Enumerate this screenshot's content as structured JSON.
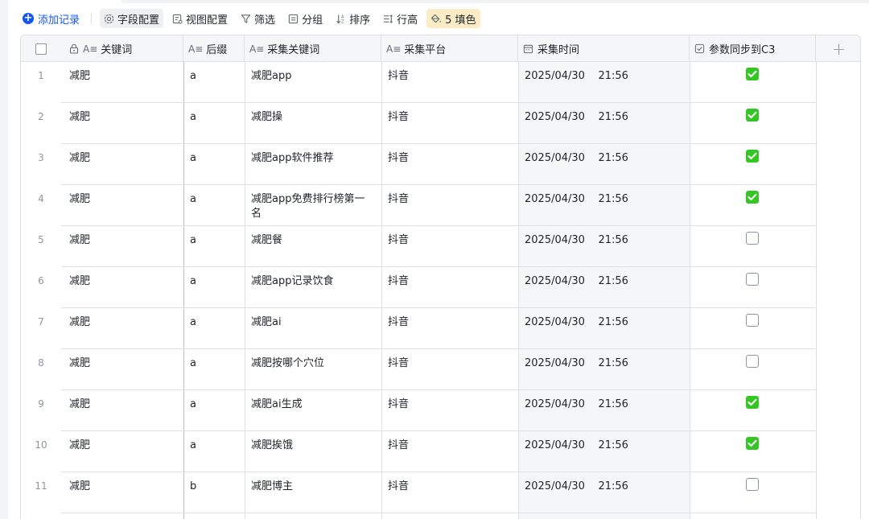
{
  "toolbar": {
    "add_label": "添加记录",
    "field_config": "字段配置",
    "view_config": "视图配置",
    "filter": "筛选",
    "group": "分组",
    "sort": "排序",
    "row_height": "行高",
    "fill": "5 填色"
  },
  "columns": {
    "keyword": "关键词",
    "suffix": "后缀",
    "collect_keyword": "采集关键词",
    "platform": "采集平台",
    "time": "采集时间",
    "sync": "参数同步到C3",
    "add": "+"
  },
  "rows": [
    {
      "idx": "1",
      "keyword": "减肥",
      "suffix": "a",
      "collect": "减肥app",
      "platform": "抖音",
      "time": "2025/04/30    21:56",
      "synced": true
    },
    {
      "idx": "2",
      "keyword": "减肥",
      "suffix": "a",
      "collect": "减肥操",
      "platform": "抖音",
      "time": "2025/04/30    21:56",
      "synced": true
    },
    {
      "idx": "3",
      "keyword": "减肥",
      "suffix": "a",
      "collect": "减肥app软件推荐",
      "platform": "抖音",
      "time": "2025/04/30    21:56",
      "synced": true
    },
    {
      "idx": "4",
      "keyword": "减肥",
      "suffix": "a",
      "collect": "减肥app免费排行榜第一名",
      "platform": "抖音",
      "time": "2025/04/30    21:56",
      "synced": true
    },
    {
      "idx": "5",
      "keyword": "减肥",
      "suffix": "a",
      "collect": "减肥餐",
      "platform": "抖音",
      "time": "2025/04/30    21:56",
      "synced": false
    },
    {
      "idx": "6",
      "keyword": "减肥",
      "suffix": "a",
      "collect": "减肥app记录饮食",
      "platform": "抖音",
      "time": "2025/04/30    21:56",
      "synced": false
    },
    {
      "idx": "7",
      "keyword": "减肥",
      "suffix": "a",
      "collect": "减肥ai",
      "platform": "抖音",
      "time": "2025/04/30    21:56",
      "synced": false
    },
    {
      "idx": "8",
      "keyword": "减肥",
      "suffix": "a",
      "collect": "减肥按哪个穴位",
      "platform": "抖音",
      "time": "2025/04/30    21:56",
      "synced": false
    },
    {
      "idx": "9",
      "keyword": "减肥",
      "suffix": "a",
      "collect": "减肥ai生成",
      "platform": "抖音",
      "time": "2025/04/30    21:56",
      "synced": true
    },
    {
      "idx": "10",
      "keyword": "减肥",
      "suffix": "a",
      "collect": "减肥挨饿",
      "platform": "抖音",
      "time": "2025/04/30    21:56",
      "synced": true
    },
    {
      "idx": "11",
      "keyword": "减肥",
      "suffix": "b",
      "collect": "减肥博主",
      "platform": "抖音",
      "time": "2025/04/30    21:56",
      "synced": false
    }
  ],
  "colors": {
    "accent": "#1456f0",
    "checked": "#34c724",
    "fill_highlight": "#fbecc6"
  }
}
